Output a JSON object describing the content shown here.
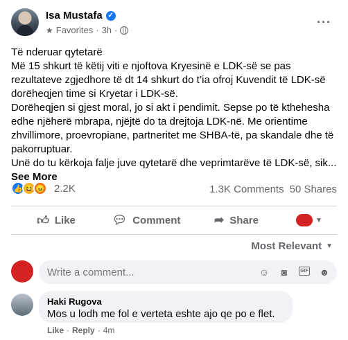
{
  "post": {
    "author": "Isa Mustafa",
    "audience": "Favorites",
    "time": "3h",
    "text_lines": [
      "Të nderuar qytetarë",
      "Më 15 shkurt të këtij viti e  njoftova Kryesinë e LDK-së se pas rezultateve zgjedhore të dt 14 shkurt do t’ia ofroj Kuvendit të LDK-së dorëheqjen time si Kryetar i LDK-së.",
      "Dorëheqjen si gjest moral, jo si akt i pendimit. Sepse po të kthehesha edhe njëherë mbrapa, njëjtë do ta drejtoja LDK-në. Me orientime zhvillimore, proevropiane, partneritet me SHBA-të, pa skandale dhe të pakorruptuar.",
      "Unë do tu kërkoja falje juve qytetarë dhe veprimtarëve të LDK-së, sik..."
    ],
    "see_more": "See More"
  },
  "stats": {
    "reactions": "2.2K",
    "comments": "1.3K Comments",
    "shares": "50 Shares"
  },
  "actions": {
    "like": "Like",
    "comment": "Comment",
    "share": "Share"
  },
  "sort_label": "Most Relevant",
  "composer": {
    "placeholder": "Write a comment..."
  },
  "comment": {
    "author": "Haki Rugova",
    "text": "Mos u lodh me fol e verteta eshte ajo qe po e flet.",
    "like": "Like",
    "reply": "Reply",
    "time": "4m"
  },
  "icons": {
    "verified": "verified-badge-icon",
    "favorites": "star-icon",
    "privacy": "globe-icon",
    "more": "more-options-icon",
    "like": "thumbs-up-icon",
    "comment": "speech-bubble-icon",
    "share": "share-arrow-icon",
    "emoji": "smiley-icon",
    "camera": "camera-icon",
    "gif": "gif-icon",
    "sticker": "sticker-icon"
  },
  "colors": {
    "verified_blue": "#1877f2",
    "redacted_red": "#d42323",
    "secondary_text": "#65676b"
  }
}
